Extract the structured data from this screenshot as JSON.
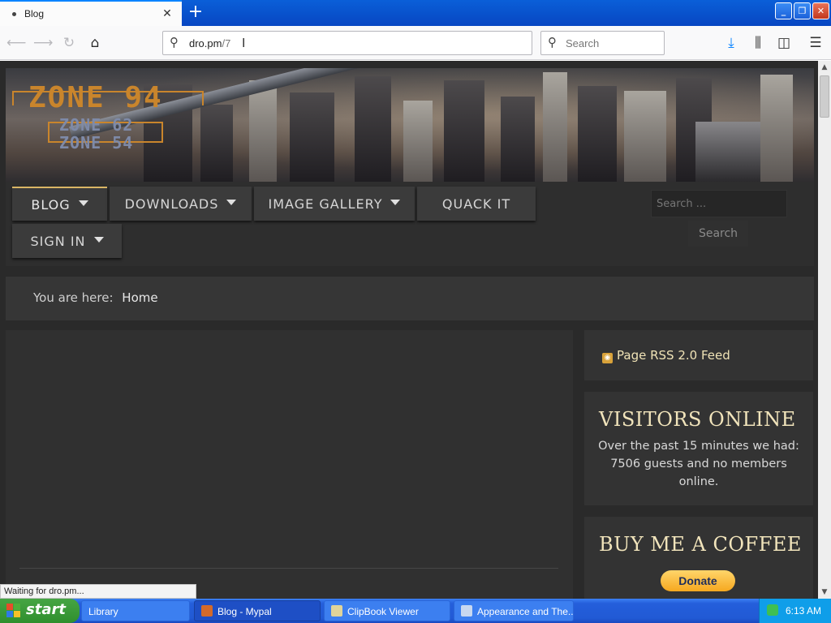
{
  "browser": {
    "tab_title": "Blog",
    "tab_close": "✕",
    "new_tab": "+",
    "url_host": "dro.pm",
    "url_path": "/7",
    "search_placeholder": "Search",
    "status_text": "Waiting for dro.pm..."
  },
  "site": {
    "logo_main": "ZONE 94",
    "logo_sub1": "ZONE 62",
    "logo_sub2": "ZONE 54",
    "menu": [
      {
        "label": "BLOG",
        "has_dropdown": true,
        "active": true
      },
      {
        "label": "DOWNLOADS",
        "has_dropdown": true
      },
      {
        "label": "IMAGE GALLERY",
        "has_dropdown": true
      },
      {
        "label": "QUACK IT",
        "has_dropdown": false
      },
      {
        "label": "SIGN IN",
        "has_dropdown": true
      }
    ],
    "search_placeholder": "Search ...",
    "search_button": "Search",
    "breadcrumb_prefix": "You are here:",
    "breadcrumb_current": "Home",
    "rss_label": "Page RSS 2.0 Feed",
    "visitors_title": "VISITORS ONLINE",
    "visitors_text": "Over the past 15 minutes we had: 7506 guests and no members online.",
    "coffee_title": "BUY ME A COFFEE",
    "donate_label": "Donate"
  },
  "taskbar": {
    "start_label": "start",
    "tasks": [
      {
        "label": "Library"
      },
      {
        "label": "Blog - Mypal"
      },
      {
        "label": "ClipBook Viewer"
      },
      {
        "label": "Appearance and The..."
      }
    ],
    "clock": "6:13 AM"
  },
  "colors": {
    "accent_gold": "#f1e4bb",
    "menu_active_border": "#d9b565",
    "taskbar_blue": "#245edb",
    "start_green": "#3a9d38"
  }
}
